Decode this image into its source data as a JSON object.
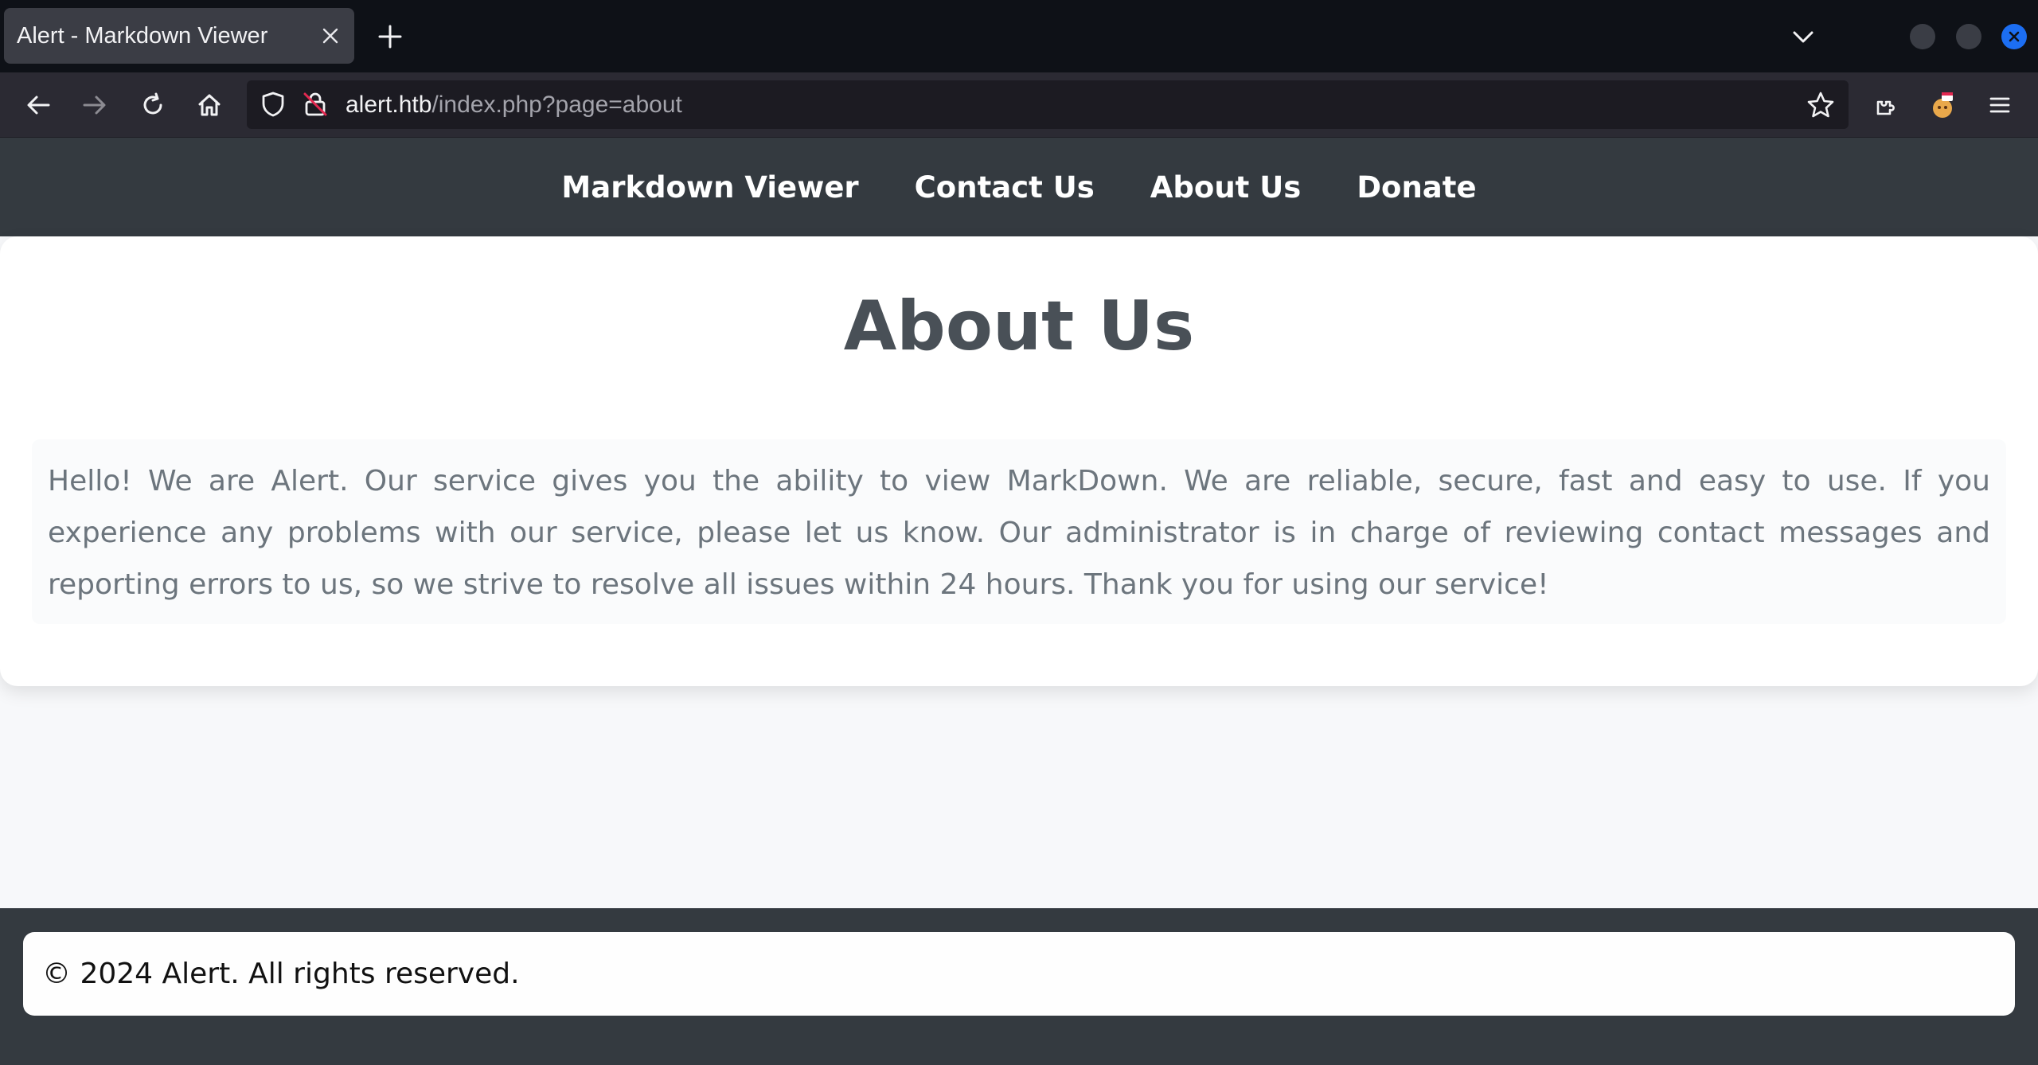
{
  "browser": {
    "tab_title": "Alert - Markdown Viewer",
    "url_host": "alert.htb",
    "url_path": "/index.php?page=about",
    "icons": [
      "close-icon",
      "plus-icon",
      "chevron-down-icon",
      "back-arrow-icon",
      "forward-arrow-icon",
      "reload-icon",
      "home-icon",
      "shield-icon",
      "lock-icon",
      "star-icon",
      "extensions-icon",
      "profile-icon",
      "menu-icon"
    ]
  },
  "site_nav": {
    "items": [
      "Markdown Viewer",
      "Contact Us",
      "About Us",
      "Donate"
    ]
  },
  "main": {
    "title": "About Us",
    "body": "Hello! We are Alert. Our service gives you the ability to view MarkDown. We are reliable, secure, fast and easy to use. If you experience any problems with our service, please let us know. Our administrator is in charge of reviewing contact messages and reporting errors to us, so we strive to resolve all issues within 24 hours. Thank you for using our service!"
  },
  "footer": {
    "text": "© 2024 Alert. All rights reserved."
  },
  "colors": {
    "nav_bg": "#343a40",
    "title": "#495057",
    "body_text": "#6c757d",
    "page_bg": "#f7f8fa",
    "window_close": "#1c6ef2"
  }
}
